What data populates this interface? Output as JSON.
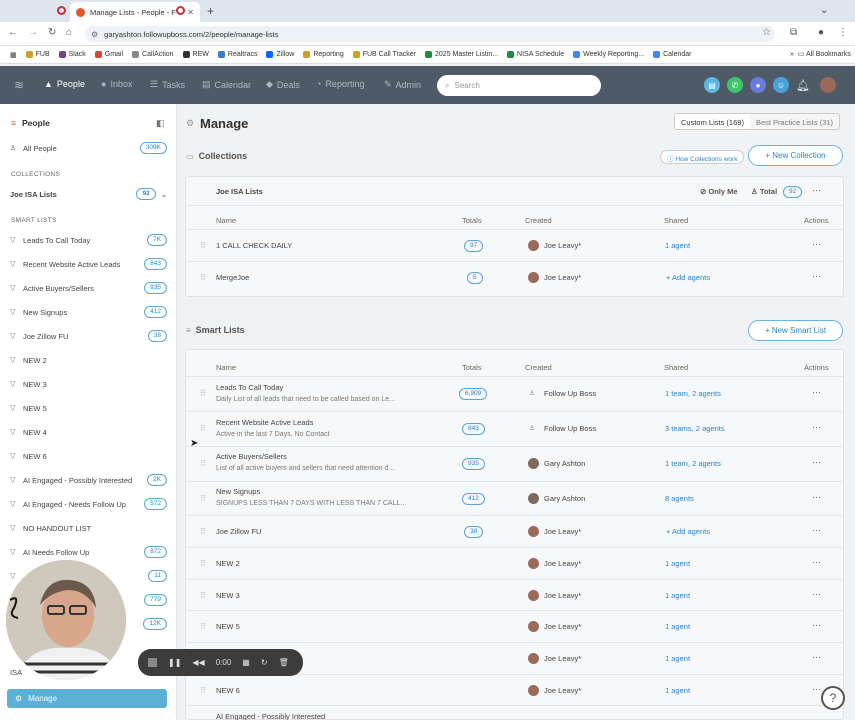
{
  "browser": {
    "tab_title": "Manage Lists - People - F",
    "url": "garyashton.followupboss.com/2/people/manage-lists",
    "bookmarks": [
      "FUB",
      "Slack",
      "Gmail",
      "CallAction",
      "REW",
      "Realtracs",
      "Zillow",
      "Reporting",
      "FUB Call Tracker",
      "2025 Master Listin...",
      "NISA Schedule",
      "Weekly Reporting...",
      "Calendar"
    ],
    "all_bookmarks": "All Bookmarks"
  },
  "appnav": {
    "items": [
      "People",
      "Inbox",
      "Tasks",
      "Calendar",
      "Deals",
      "Reporting",
      "Admin"
    ],
    "search_placeholder": "Search"
  },
  "sidebar": {
    "title": "People",
    "all_people": {
      "label": "All People",
      "count": "309K"
    },
    "collections_header": "COLLECTIONS",
    "collection": {
      "label": "Joe ISA Lists",
      "count": "92"
    },
    "smart_header": "SMART LISTS",
    "items": [
      {
        "label": "Leads To Call Today",
        "count": "7K"
      },
      {
        "label": "Recent Website Active Leads",
        "count": "843"
      },
      {
        "label": "Active Buyers/Sellers",
        "count": "935"
      },
      {
        "label": "New Signups",
        "count": "412"
      },
      {
        "label": "Joe Zillow FU",
        "count": "38"
      },
      {
        "label": "NEW 2",
        "count": ""
      },
      {
        "label": "NEW 3",
        "count": ""
      },
      {
        "label": "NEW 5",
        "count": ""
      },
      {
        "label": "NEW 4",
        "count": ""
      },
      {
        "label": "NEW 6",
        "count": ""
      },
      {
        "label": "AI Engaged - Possibly Interested",
        "count": "2K"
      },
      {
        "label": "AI Engaged - Needs Follow Up",
        "count": "572"
      },
      {
        "label": "NO HANDOUT LIST",
        "count": ""
      },
      {
        "label": "AI Needs Follow Up",
        "count": "872"
      }
    ],
    "hidden_counts": [
      "11",
      "779",
      "12K"
    ],
    "partial_label": "ISA",
    "manage_label": "Manage"
  },
  "main": {
    "title": "Manage",
    "tabs": [
      "Custom Lists (169)",
      "Best Practice Lists (31)"
    ],
    "collections_title": "Collections",
    "how_collections": "How Collections work",
    "new_collection": "+ New Collection",
    "collection_card": {
      "name": "Joe ISA Lists",
      "only_me": "Only Me",
      "total_label": "Total",
      "total": "92",
      "headers": [
        "Name",
        "Totals",
        "Created",
        "Shared",
        "Actions"
      ],
      "rows": [
        {
          "name": "1 CALL CHECK DAILY",
          "total": "97",
          "created": "Joe Leavy*",
          "shared": "1 agent"
        },
        {
          "name": "MergeJoe",
          "total": "5",
          "created": "Joe Leavy*",
          "shared": "+ Add agents"
        }
      ]
    },
    "smart_title": "Smart Lists",
    "new_smart": "+ New Smart List",
    "smart_headers": [
      "Name",
      "Totals",
      "Created",
      "Shared",
      "Actions"
    ],
    "smart_rows": [
      {
        "name": "Leads To Call Today",
        "sub": "Daily List of all leads that need to be called based on Le...",
        "total": "6,909",
        "created": "Follow Up Boss",
        "shared": "1 team, 2 agents"
      },
      {
        "name": "Recent Website Active Leads",
        "sub": "Active in the last 7 Days, No Contact",
        "total": "843",
        "created": "Follow Up Boss",
        "shared": "3 teams, 2 agents"
      },
      {
        "name": "Active Buyers/Sellers",
        "sub": "List of all active buyers and sellers that need attention d...",
        "total": "935",
        "created": "Gary Ashton",
        "shared": "1 team, 2 agents"
      },
      {
        "name": "New Signups",
        "sub": "SIGNUPS LESS THAN 7 DAYS WITH LESS THAN 7 CALL...",
        "total": "412",
        "created": "Gary Ashton",
        "shared": "8 agents"
      },
      {
        "name": "Joe Zillow FU",
        "sub": "",
        "total": "38",
        "created": "Joe Leavy*",
        "shared": "+ Add agents"
      },
      {
        "name": "NEW 2",
        "sub": "",
        "total": "",
        "created": "Joe Leavy*",
        "shared": "1 agent"
      },
      {
        "name": "NEW 3",
        "sub": "",
        "total": "",
        "created": "Joe Leavy*",
        "shared": "1 agent"
      },
      {
        "name": "NEW 5",
        "sub": "",
        "total": "",
        "created": "Joe Leavy*",
        "shared": "1 agent"
      },
      {
        "name": "",
        "sub": "",
        "total": "",
        "created": "Joe Leavy*",
        "shared": "1 agent"
      },
      {
        "name": "NEW 6",
        "sub": "",
        "total": "",
        "created": "Joe Leavy*",
        "shared": "1 agent"
      },
      {
        "name": "AI Engaged - Possibly Interested",
        "sub": "",
        "total": "",
        "created": "",
        "shared": ""
      }
    ]
  },
  "player": {
    "time": "0:00"
  },
  "help": "?"
}
